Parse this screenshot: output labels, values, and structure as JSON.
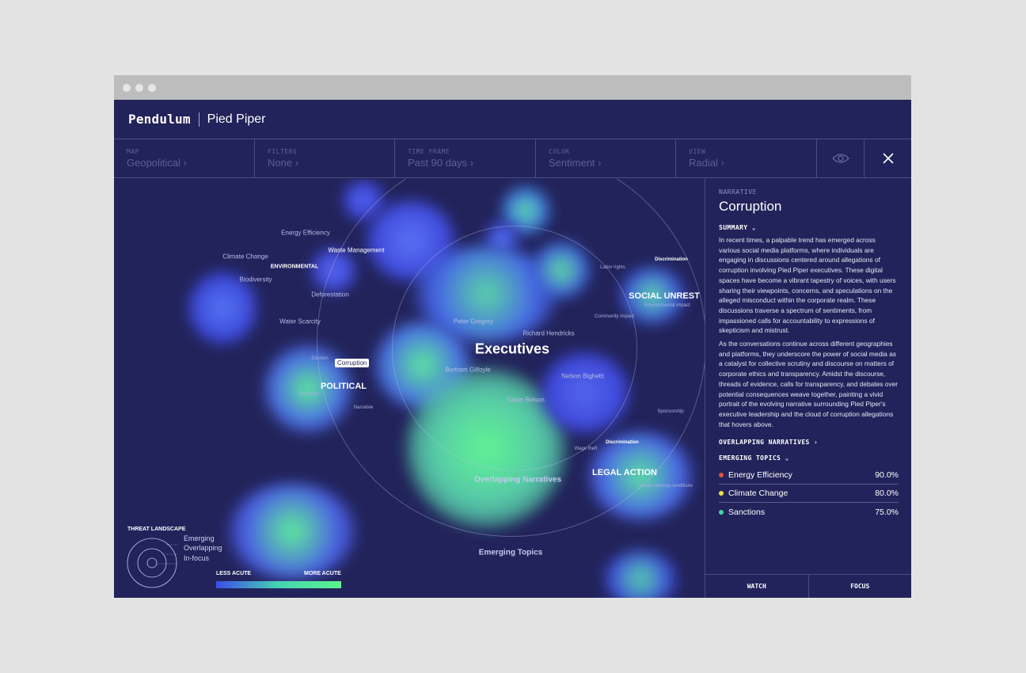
{
  "header": {
    "brand": "Pendulum",
    "project": "Pied Piper"
  },
  "filters": [
    {
      "label": "MAP",
      "value": "Geopolitical"
    },
    {
      "label": "FILTERS",
      "value": "None"
    },
    {
      "label": "TIME FRAME",
      "value": "Past 90 days"
    },
    {
      "label": "COLOR",
      "value": "Sentiment"
    },
    {
      "label": "VIEW",
      "value": "Radial"
    }
  ],
  "icons": {
    "view_toggle": "eye-icon",
    "close": "close-icon"
  },
  "map": {
    "center_label": "Executives",
    "categories": [
      "ENVIRONMENTAL",
      "POLITICAL",
      "SOCIAL UNREST",
      "LEGAL ACTION"
    ],
    "ring_labels": [
      "Overlapping Narratives",
      "Emerging Topics"
    ],
    "selected_tag": "Corruption",
    "env_topics": [
      "Energy Efficiency",
      "Climate Change",
      "Waste Management",
      "Biodiversity",
      "Deforestation",
      "Water Scarcity"
    ],
    "people": [
      "Peter Gregory",
      "Richard Hendricks",
      "Bertram Gilfoyle",
      "Nelson Bighetti",
      "Gavin Belson"
    ],
    "political_topics": [
      "Election",
      "Sanctions",
      "Narrative"
    ],
    "social_topics": [
      "Labor rights",
      "Discrimination",
      "Environmental impact",
      "Community impact"
    ],
    "legal_topics": [
      "Sponsorship",
      "Discrimination",
      "Wage theft",
      "Unsafe working conditions"
    ]
  },
  "legend": {
    "title": "THREAT LANDSCAPE",
    "items": [
      "Emerging",
      "Overlapping",
      "In-focus"
    ],
    "less": "LESS ACUTE",
    "more": "MORE ACUTE"
  },
  "colors": {
    "background": "#22235a",
    "low": "#3b4ce8",
    "high": "#5cf58e"
  },
  "panel": {
    "kicker": "NARRATIVE",
    "title": "Corruption",
    "summary_label": "SUMMARY",
    "paragraphs": [
      "In recent times, a palpable trend has emerged across various social media platforms, where individuals are engaging in discussions centered around allegations of corruption involving Pied Piper executives. These digital spaces have become a vibrant tapestry of voices, with users sharing their viewpoints, concerns, and speculations on the alleged misconduct within the corporate realm. These discussions traverse a spectrum of sentiments, from impassioned calls for accountability to expressions of skepticism and mistrust.",
      "As the conversations continue across different geographies and platforms, they underscore the power of social media as a catalyst for collective scrutiny and discourse on matters of corporate ethics and transparency. Amidst the discourse, threads of evidence, calls for transparency, and debates over potential consequences weave together, painting a vivid portrait of the evolving narrative surrounding Pied Piper's executive leadership and the cloud of corruption allegations that hovers above."
    ],
    "overlapping_label": "OVERLAPPING NARRATIVES",
    "emerging_label": "EMERGING TOPICS",
    "topics": [
      {
        "name": "Energy Efficiency",
        "value": "90.0%",
        "color": "#e0503a"
      },
      {
        "name": "Climate Change",
        "value": "80.0%",
        "color": "#e8e23a"
      },
      {
        "name": "Sanctions",
        "value": "75.0%",
        "color": "#3fd7a4"
      }
    ],
    "watch_label": "WATCH",
    "focus_label": "FOCUS"
  }
}
